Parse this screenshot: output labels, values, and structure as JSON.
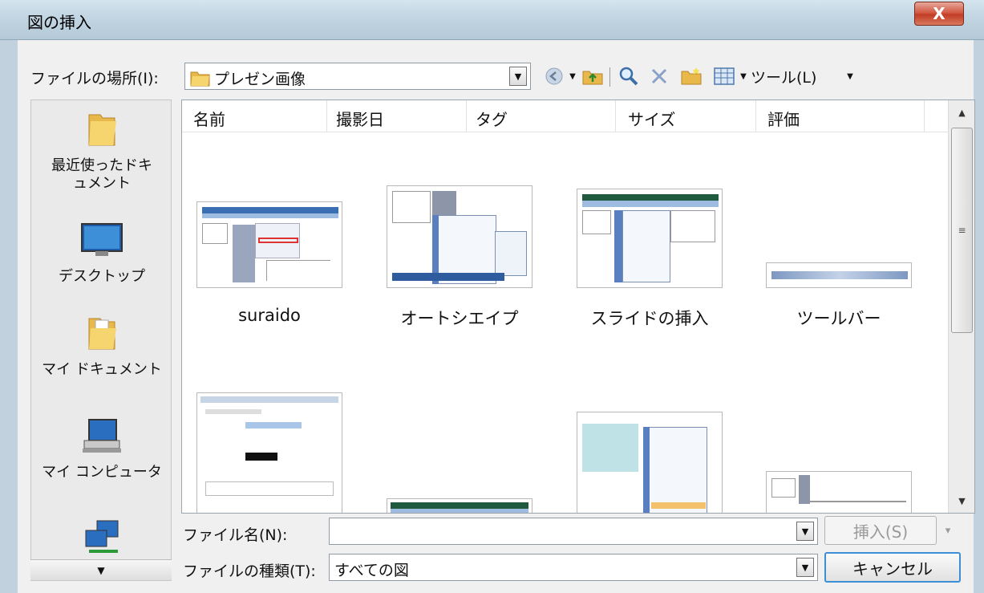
{
  "window": {
    "title": "図の挿入",
    "close_glyph": "X"
  },
  "look_in": {
    "label": "ファイルの場所(I):",
    "value": "プレゼン画像"
  },
  "toolbar": {
    "tools_label": "ツール(L)"
  },
  "places": [
    {
      "label": "最近使ったドキュメント",
      "icon": "recent-folder-icon"
    },
    {
      "label": "デスクトップ",
      "icon": "desktop-icon"
    },
    {
      "label": "マイ ドキュメント",
      "icon": "documents-folder-icon"
    },
    {
      "label": "マイ コンピュータ",
      "icon": "computer-icon"
    },
    {
      "label": "",
      "icon": "network-icon"
    }
  ],
  "columns": [
    "名前",
    "撮影日",
    "タグ",
    "サイズ",
    "評価"
  ],
  "files": [
    {
      "name": "suraido"
    },
    {
      "name": "オートシエイプ"
    },
    {
      "name": "スライドの挿入"
    },
    {
      "name": "ツールバー"
    }
  ],
  "file_name": {
    "label": "ファイル名(N):",
    "value": ""
  },
  "file_type": {
    "label": "ファイルの種類(T):",
    "value": "すべての図"
  },
  "buttons": {
    "insert": "挿入(S)",
    "cancel": "キャンセル"
  },
  "colors": {
    "accent": "#3c8fd6",
    "close": "#c23c24",
    "folder": "#e8b84a"
  }
}
